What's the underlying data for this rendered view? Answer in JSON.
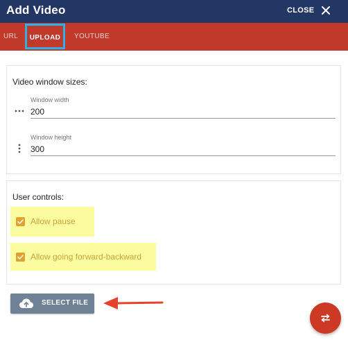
{
  "header": {
    "title": "Add Video",
    "close_label": "CLOSE",
    "close_icon": "close-icon"
  },
  "tabs": [
    {
      "label": "URL",
      "active": false
    },
    {
      "label": "UPLOAD",
      "active": true
    },
    {
      "label": "YOUTUBE",
      "active": false
    }
  ],
  "sizes": {
    "heading": "Video window sizes:",
    "width": {
      "label": "Window width",
      "value": "200",
      "icon": "horizontal-dots-icon"
    },
    "height": {
      "label": "Window height",
      "value": "300",
      "icon": "vertical-dots-icon"
    }
  },
  "controls": {
    "heading": "User controls:",
    "options": [
      {
        "label": "Allow pause",
        "checked": true
      },
      {
        "label": "Allow going forward-backward",
        "checked": true
      }
    ]
  },
  "select_file": {
    "label": "SELECT FILE",
    "icon": "cloud-upload-icon"
  },
  "fab": {
    "icon": "swap-arrows-icon"
  },
  "colors": {
    "header": "#233765",
    "tabbar": "#c0392b",
    "active_tab_outline": "#2bb1e8",
    "checkbox": "#e2a12e",
    "highlight": "#fbfba0",
    "select_button": "#6e8195",
    "fab": "#cc3a25",
    "annotation_arrow": "#e5432e"
  }
}
